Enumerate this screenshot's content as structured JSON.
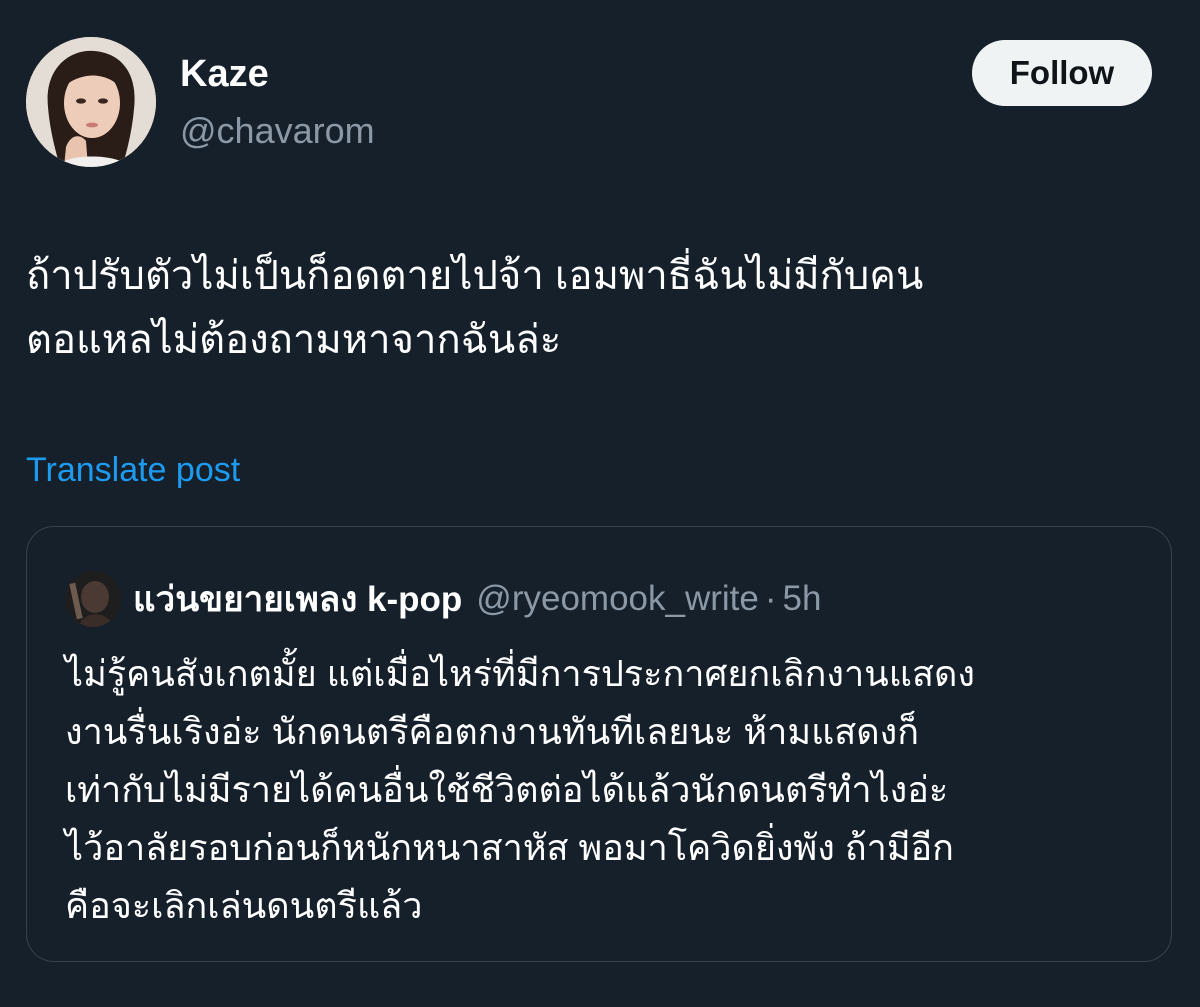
{
  "author": {
    "display_name": "Kaze",
    "handle": "@chavarom",
    "avatar_icon": "profile-photo"
  },
  "follow_label": "Follow",
  "post": {
    "text": "ถ้าปรับตัวไม่เป็นก็อดตายไปจ้า เอมพาธี่ฉันไม่มีกับคน\nตอแหลไม่ต้องถามหาจากฉันล่ะ",
    "translate_label": "Translate post"
  },
  "quoted_post": {
    "display_name": "แว่นขยายเพลง k-pop",
    "handle": "@ryeomook_write",
    "separator": "·",
    "time": "5h",
    "text": "ไม่รู้คนสังเกตมั้ย แต่เมื่อไหร่ที่มีการประกาศยกเลิกงานแสดง\nงานรื่นเริงอ่ะ นักดนตรีคือตกงานทันทีเลยนะ ห้ามแสดงก็\nเท่ากับไม่มีรายได้คนอื่นใช้ชีวิตต่อได้แล้วนักดนตรีทำไงอ่ะ\nไว้อาลัยรอบก่อนก็หนักหนาสาหัส พอมาโควิดยิ่งพัง ถ้ามีอีก\nคือจะเลิกเล่นดนตรีแล้ว"
  },
  "colors": {
    "background": "#15202b",
    "primary_text": "#ffffff",
    "secondary_text": "#8b98a5",
    "link": "#1d9bf0",
    "follow_button_bg": "#eff3f4",
    "border": "#38444d"
  }
}
